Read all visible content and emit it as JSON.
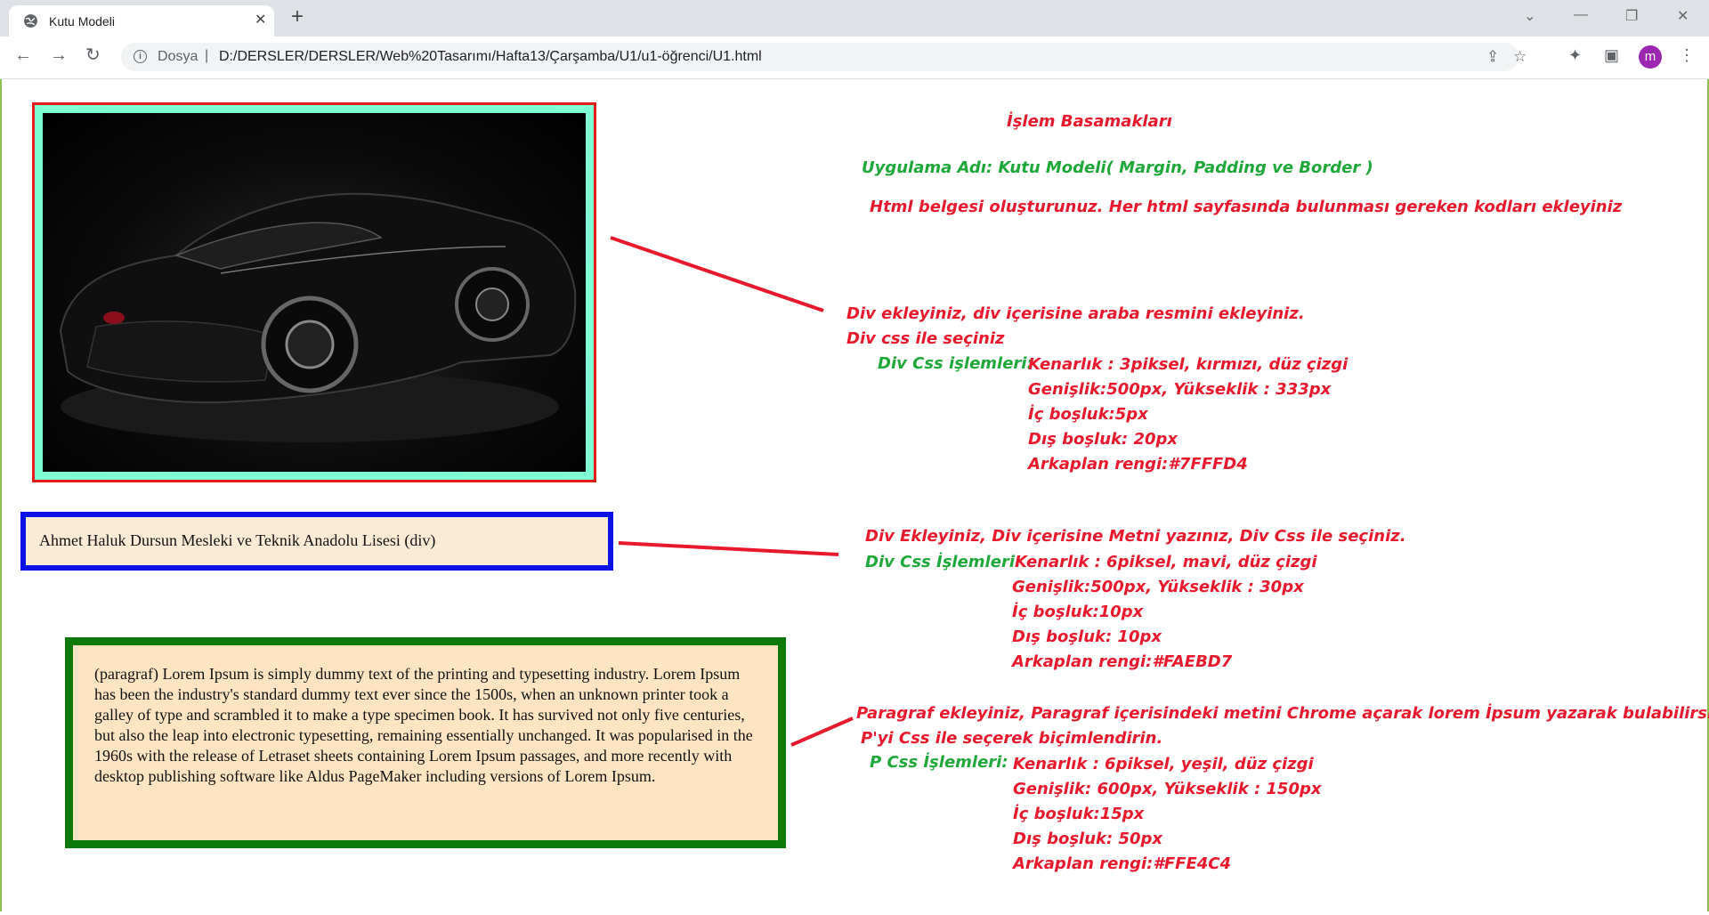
{
  "browser": {
    "tab_title": "Kutu Modeli",
    "new_tab": "+",
    "scheme_label": "Dosya",
    "url": "D:/DERSLER/DERSLER/Web%20Tasarımı/Hafta13/Çarşamba/U1/u1-öğrenci/U1.html",
    "avatar_letter": "m"
  },
  "page": {
    "div_text": "Ahmet Haluk Dursun Mesleki ve Teknik Anadolu Lisesi (div)",
    "paragraph": "(paragraf) Lorem Ipsum is simply dummy text of the printing and typesetting industry. Lorem Ipsum has been the industry's standard dummy text ever since the 1500s, when an unknown printer took a galley of type and scrambled it to make a type specimen book. It has survived not only five centuries, but also the leap into electronic typesetting, remaining essentially unchanged. It was popularised in the 1960s with the release of Letraset sheets containing Lorem Ipsum passages, and more recently with desktop publishing software like Aldus PageMaker including versions of Lorem Ipsum."
  },
  "notes": {
    "title": "İşlem Basamakları",
    "app_name": "Uygulama Adı: Kutu Modeli( Margin, Padding ve Border )",
    "html_step": "Html belgesi oluşturunuz. Her html sayfasında bulunması gereken kodları ekleyiniz",
    "img": {
      "line1": "Div ekleyiniz, div içerisine araba resmini ekleyiniz.",
      "line2": "Div css ile seçiniz",
      "css_label": "Div Css işlemleri:",
      "props": [
        "Kenarlık : 3piksel, kırmızı, düz çizgi",
        "Genişlik:500px, Yükseklik : 333px",
        "İç boşluk:5px",
        "Dış boşluk: 20px",
        "Arkaplan rengi:#7FFFD4"
      ]
    },
    "div": {
      "line1": "Div Ekleyiniz, Div içerisine Metni yazınız, Div Css ile seçiniz.",
      "css_label": "Div Css İşlemleri:",
      "props": [
        "Kenarlık : 6piksel, mavi, düz çizgi",
        "Genişlik:500px, Yükseklik : 30px",
        "İç boşluk:10px",
        "Dış boşluk: 10px",
        "Arkaplan rengi:#FAEBD7"
      ]
    },
    "p": {
      "line1": "Paragraf ekleyiniz, Paragraf içerisindeki metini Chrome açarak lorem  İpsum yazarak bulabilirsiniz",
      "line2": "P'yi Css ile seçerek biçimlendirin.",
      "css_label": "P Css İşlemleri:",
      "props": [
        "Kenarlık : 6piksel, yeşil, düz çizgi",
        "Genişlik: 600px, Yükseklik : 150px",
        "İç boşluk:15px",
        "Dış boşluk: 50px",
        "Arkaplan rengi:#FFE4C4"
      ]
    }
  },
  "colors": {
    "accent_red": "#e8192c",
    "accent_green": "#1ea83a",
    "img_bg": "#7FFFD4",
    "div_bg": "#FAEBD7",
    "p_bg": "#FFE4C4"
  }
}
